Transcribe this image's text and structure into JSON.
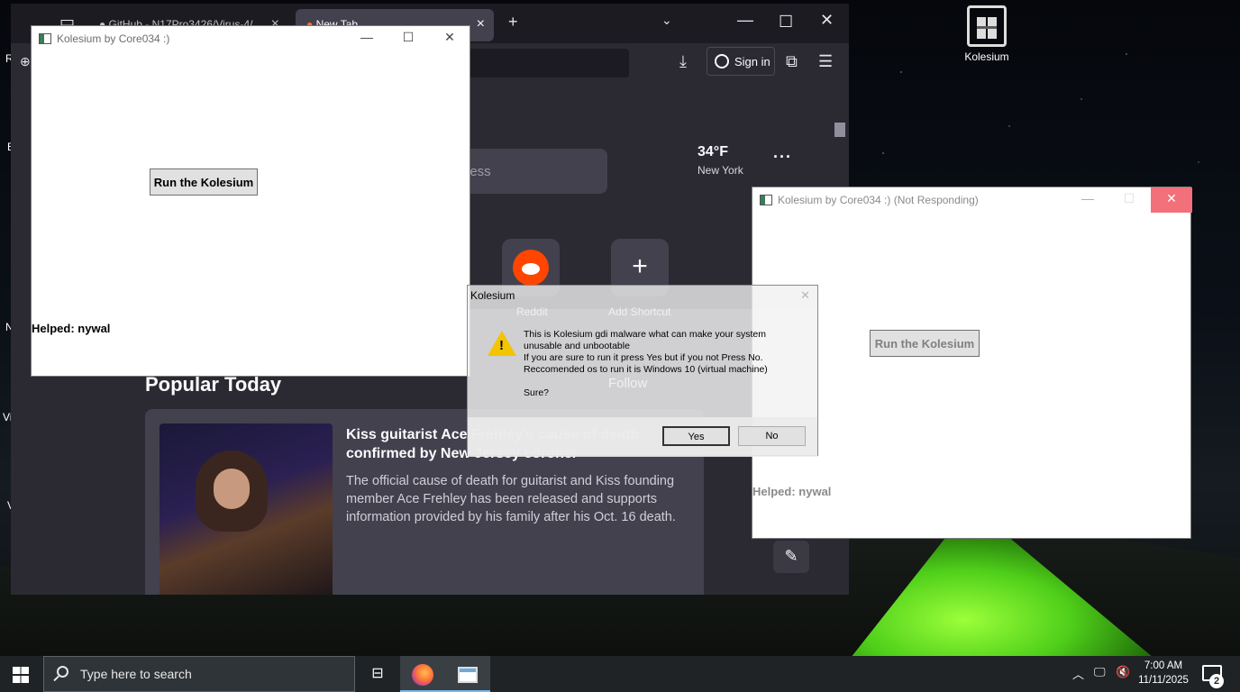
{
  "desktop": {
    "icon_label": "Kolesium"
  },
  "browser": {
    "tabs": [
      {
        "label": "GitHub - N17Pro3426/Virus-4/..."
      },
      {
        "label": "New Tab"
      }
    ],
    "sign_in_label": "Sign in",
    "search_placeholder": "dress",
    "weather": {
      "temp": "34°F",
      "city": "New York"
    },
    "shortcuts": [
      {
        "label": "Reddit"
      },
      {
        "label": "Add Shortcut"
      }
    ],
    "popular_heading": "Popular Today",
    "follow_label": "Follow",
    "article": {
      "title": "Kiss guitarist Ace Frehley's cause of death confirmed by New Jersey coroner",
      "description": "The official cause of death for guitarist and Kiss founding member Ace Frehley has been released and supports information provided by his family after his Oct. 16 death."
    }
  },
  "kolesium_window_1": {
    "title": "Kolesium by Core034 :)",
    "run_button": "Run the Kolesium",
    "helped_text": "Helped: nywal"
  },
  "kolesium_window_2": {
    "title": "Kolesium by Core034 :) (Not Responding)",
    "run_button": "Run the Kolesium",
    "helped_text": "Helped: nywal"
  },
  "dialog": {
    "title": "Kolesium",
    "message": "This is Kolesium gdi malware what can make your system\nunusable and unbootable\nIf you are sure to run it press Yes but if you not Press No.\nReccomended os to run it is Windows 10 (virtual machine)\n\nSure?",
    "yes_label": "Yes",
    "no_label": "No"
  },
  "taskbar": {
    "search_placeholder": "Type here to search",
    "time": "7:00 AM",
    "date": "11/11/2025",
    "notification_count": "2"
  },
  "colors": {
    "browser_bg": "#2b2a33",
    "taskbar_bg": "#1f2326",
    "close_hover": "#f1707a",
    "warning": "#f3c400"
  }
}
